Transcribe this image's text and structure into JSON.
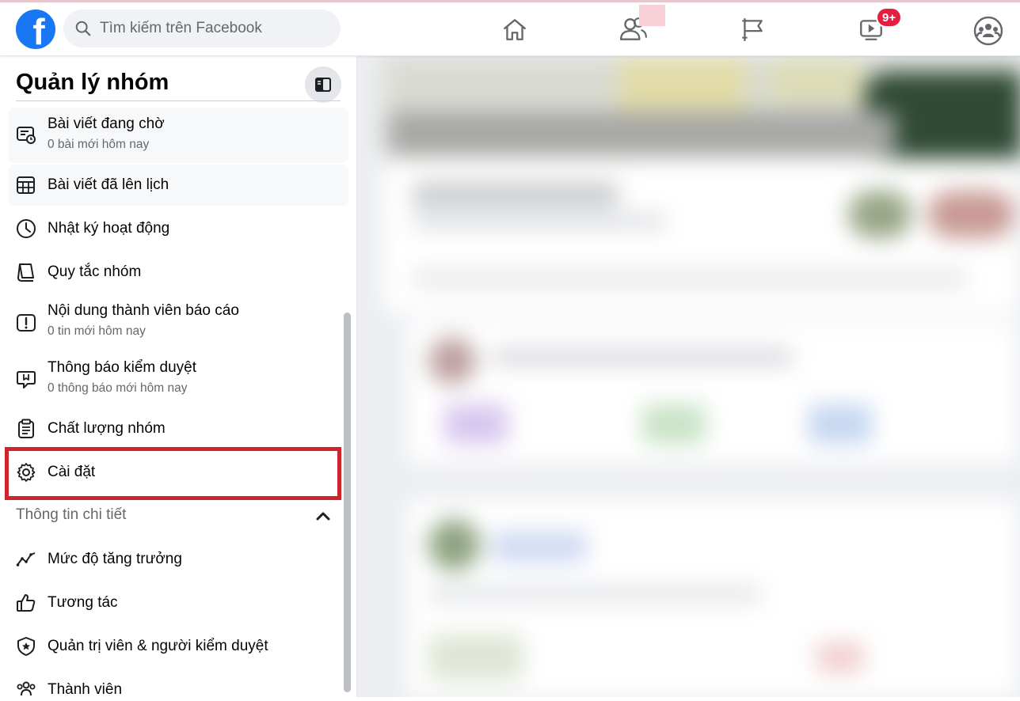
{
  "header": {
    "logo_letter": "f",
    "search": {
      "placeholder": "Tìm kiếm trên Facebook"
    },
    "nav": {
      "home": "home-icon",
      "friends": "friends-icon",
      "pages": "flag-icon",
      "watch": "watch-icon",
      "watch_badge": "9+",
      "groups": "groups-icon"
    }
  },
  "sidebar": {
    "title": "Quản lý nhóm",
    "items": [
      {
        "label": "Bài viết đang chờ",
        "sub": "0 bài mới hôm nay",
        "icon": "pending-posts-icon"
      },
      {
        "label": "Bài viết đã lên lịch",
        "sub": "",
        "icon": "calendar-icon"
      },
      {
        "label": "Nhật ký hoạt động",
        "sub": "",
        "icon": "clock-icon"
      },
      {
        "label": "Quy tắc nhóm",
        "sub": "",
        "icon": "book-icon"
      },
      {
        "label": "Nội dung thành viên báo cáo",
        "sub": "0 tin mới hôm nay",
        "icon": "report-icon"
      },
      {
        "label": "Thông báo kiểm duyệt",
        "sub": "0 thông báo mới hôm nay",
        "icon": "moderation-alert-icon"
      },
      {
        "label": "Chất lượng nhóm",
        "sub": "",
        "icon": "clipboard-icon"
      },
      {
        "label": "Cài đặt",
        "sub": "",
        "icon": "gear-icon"
      }
    ],
    "insights_section": {
      "label": "Thông tin chi tiết",
      "items": [
        {
          "label": "Mức độ tăng trưởng",
          "icon": "growth-icon"
        },
        {
          "label": "Tương tác",
          "icon": "thumbs-up-icon"
        },
        {
          "label": "Quản trị viên & người kiểm duyệt",
          "icon": "admin-shield-icon"
        },
        {
          "label": "Thành viên",
          "icon": "members-icon"
        }
      ]
    }
  },
  "colors": {
    "brand": "#1877f2",
    "badge": "#e41e3f",
    "highlight": "#d0242b"
  }
}
